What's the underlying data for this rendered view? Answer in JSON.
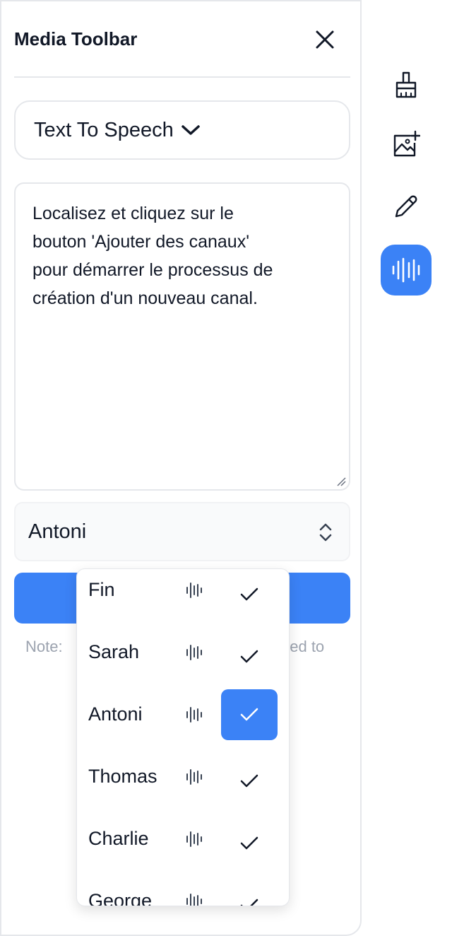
{
  "panel": {
    "title": "Media Toolbar"
  },
  "mode_select": {
    "label": "Text To Speech"
  },
  "text_input": {
    "value": "Localisez et cliquez sur le\nbouton 'Ajouter des canaux'\npour démarrer le processus de\ncréation d'un nouveau canal."
  },
  "voice_select": {
    "value": "Antoni"
  },
  "note": {
    "left": "Note:",
    "right": "eed to"
  },
  "voice_options": [
    {
      "name": "Fin",
      "selected": false
    },
    {
      "name": "Sarah",
      "selected": false
    },
    {
      "name": "Antoni",
      "selected": true
    },
    {
      "name": "Thomas",
      "selected": false
    },
    {
      "name": "Charlie",
      "selected": false
    },
    {
      "name": "George",
      "selected": false
    }
  ],
  "side_tools": [
    {
      "icon": "brush-icon"
    },
    {
      "icon": "image-add-icon"
    },
    {
      "icon": "pencil-icon"
    },
    {
      "icon": "audio-wave-icon",
      "active": true
    }
  ],
  "colors": {
    "accent": "#3b82f6",
    "border": "#e5e7eb",
    "muted_text": "#9ca3af"
  }
}
